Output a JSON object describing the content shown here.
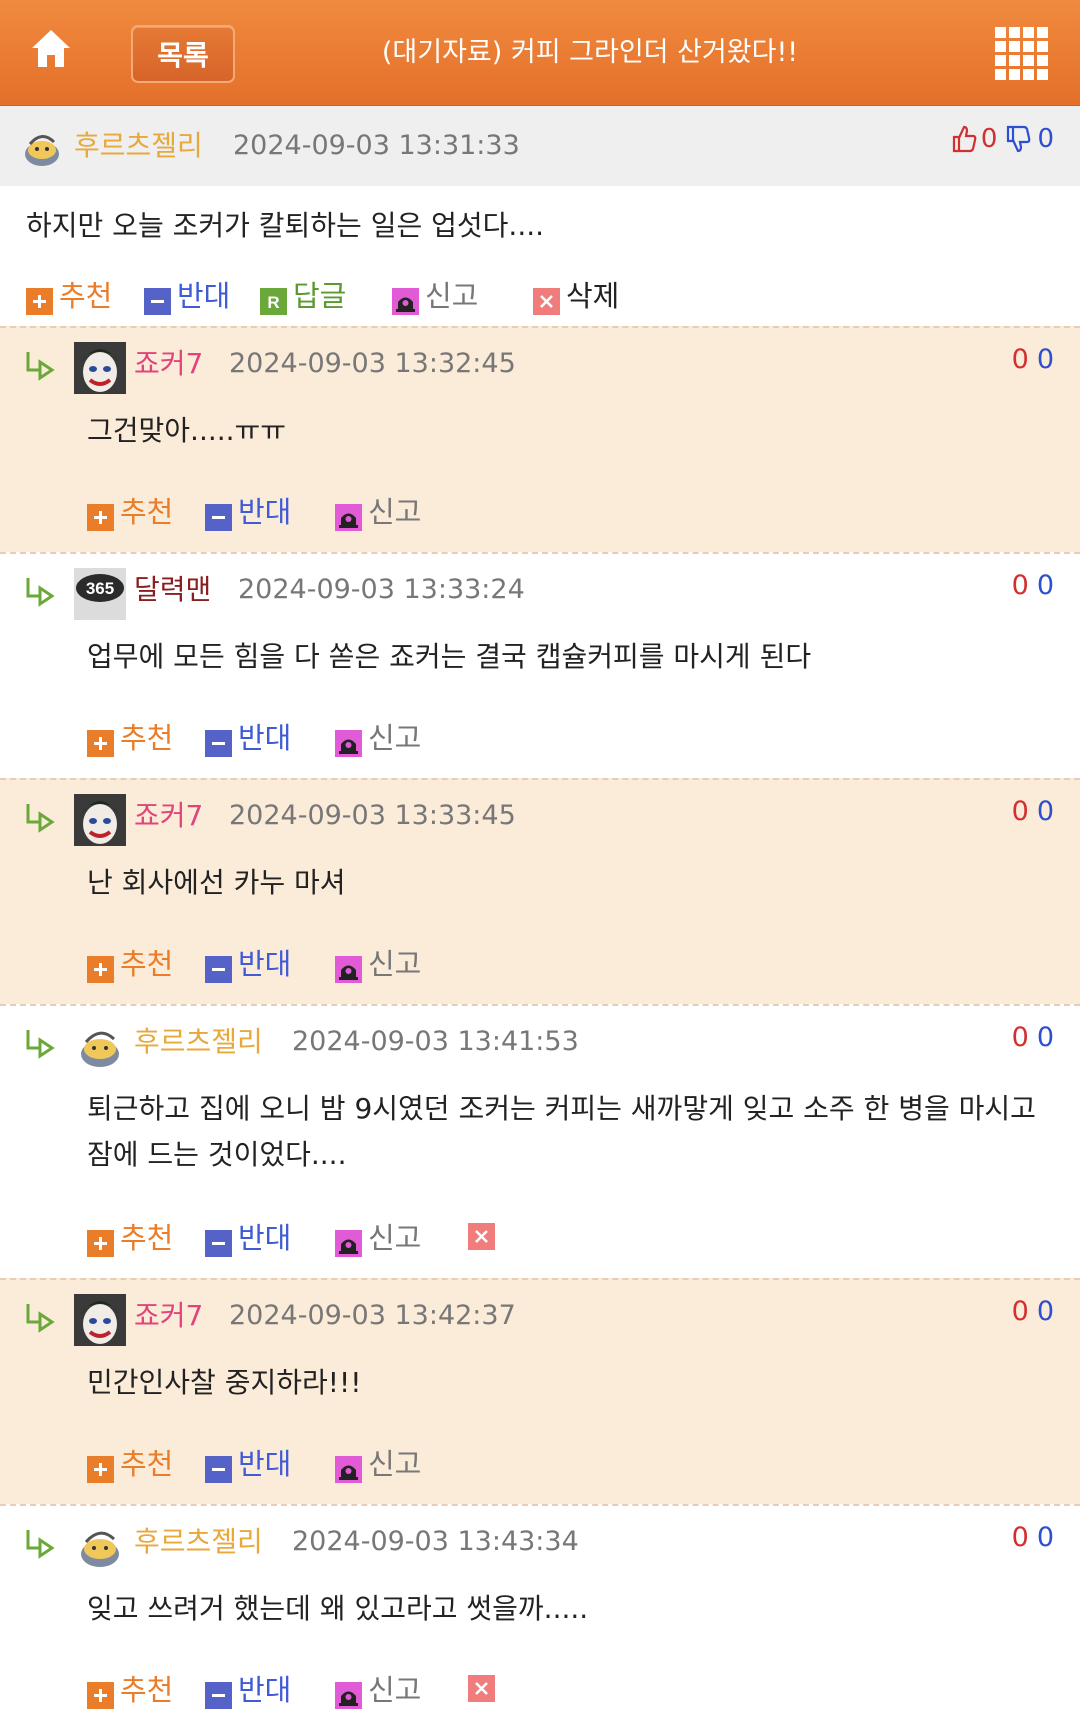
{
  "header": {
    "list_label": "목록",
    "title": "(대기자료) 커피 그라인더 산거왔다!!"
  },
  "post": {
    "author": "후르츠젤리",
    "date": "2024-09-03 13:31:33",
    "up": "0",
    "down": "0",
    "body": "하지만 오늘 조커가 칼퇴하는 일은 업섯다....",
    "actions": {
      "recommend": "추천",
      "oppose": "반대",
      "reply": "답글",
      "report": "신고",
      "delete": "삭제"
    }
  },
  "comments": [
    {
      "author": "죠커7",
      "author_color": "#e0447a",
      "avatar": "joker-avatar",
      "date": "2024-09-03 13:32:45",
      "up": "0",
      "down": "0",
      "body": "그건맞아.....ㅠㅠ",
      "recommend": "추천",
      "oppose": "반대",
      "report": "신고"
    },
    {
      "author": "달력맨",
      "author_color": "#8a1e1e",
      "avatar": "365-avatar",
      "date": "2024-09-03 13:33:24",
      "up": "0",
      "down": "0",
      "body": "업무에 모든 힘을 다 쏟은 죠커는 결국 캡슐커피를 마시게 된다",
      "recommend": "추천",
      "oppose": "반대",
      "report": "신고"
    },
    {
      "author": "죠커7",
      "author_color": "#e0447a",
      "avatar": "joker-avatar",
      "date": "2024-09-03 13:33:45",
      "up": "0",
      "down": "0",
      "body": "난 회사에선 카누 마셔",
      "recommend": "추천",
      "oppose": "반대",
      "report": "신고"
    },
    {
      "author": "후르츠젤리",
      "author_color": "#e8a83a",
      "avatar": "jelly-avatar",
      "date": "2024-09-03 13:41:53",
      "up": "0",
      "down": "0",
      "body": "퇴근하고 집에 오니 밤 9시였던 조커는 커피는 새까맣게 잊고 소주 한 병을 마시고 잠에 드는 것이었다....",
      "recommend": "추천",
      "oppose": "반대",
      "report": "신고"
    },
    {
      "author": "죠커7",
      "author_color": "#e0447a",
      "avatar": "joker-avatar",
      "date": "2024-09-03 13:42:37",
      "up": "0",
      "down": "0",
      "body": "민간인사찰 중지하라!!!",
      "recommend": "추천",
      "oppose": "반대",
      "report": "신고"
    },
    {
      "author": "후르츠젤리",
      "author_color": "#e8a83a",
      "avatar": "jelly-avatar",
      "date": "2024-09-03 13:43:34",
      "up": "0",
      "down": "0",
      "body": "잊고 쓰려거 했는데 왜 있고라고 썻을까.....",
      "recommend": "추천",
      "oppose": "반대",
      "report": "신고"
    }
  ],
  "colors": {
    "header": "#e8782f",
    "recommend": "#ea7d29",
    "oppose": "#3f5bd6",
    "reply": "#5c9a2f",
    "up": "#d23030",
    "down": "#2d4fd0",
    "alt_row": "#fbebd9"
  }
}
